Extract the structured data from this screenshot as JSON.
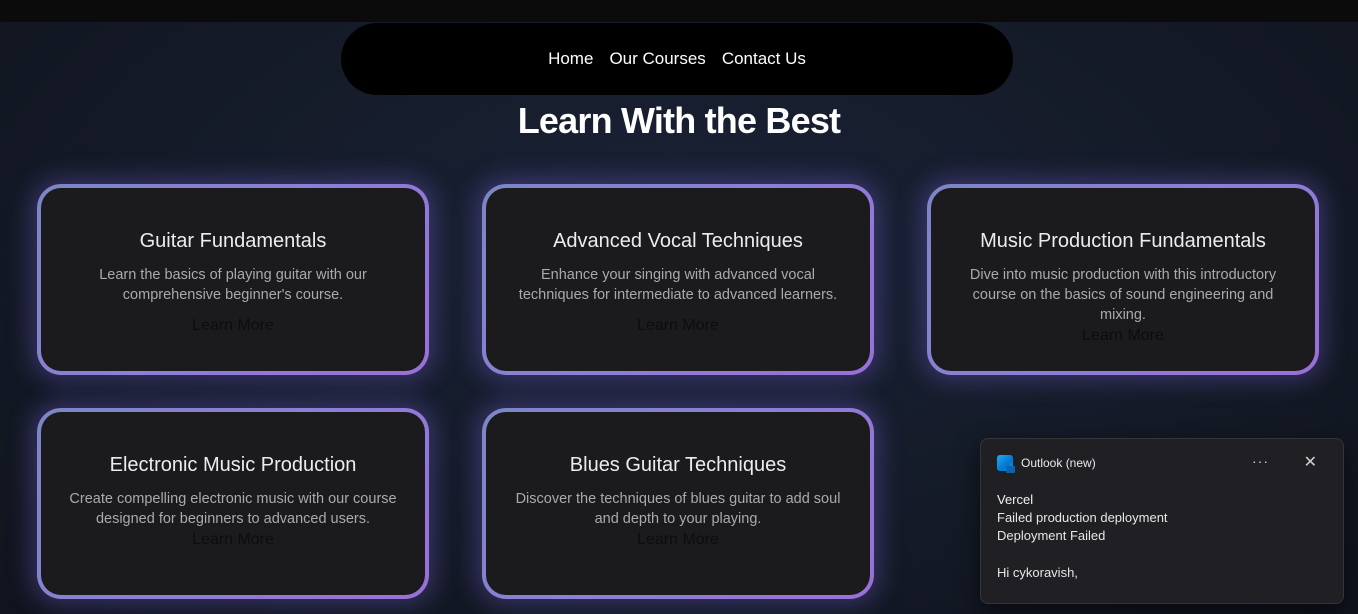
{
  "nav": {
    "items": [
      "Home",
      "Our Courses",
      "Contact Us"
    ]
  },
  "heading": "Learn With the Best",
  "courses": [
    {
      "title": "Guitar Fundamentals",
      "description": "Learn the basics of playing guitar with our comprehensive beginner's course.",
      "link": "Learn More"
    },
    {
      "title": "Advanced Vocal Techniques",
      "description": "Enhance your singing with advanced vocal techniques for intermediate to advanced learners.",
      "link": "Learn More"
    },
    {
      "title": "Music Production Fundamentals",
      "description": "Dive into music production with this introductory course on the basics of sound engineering and mixing.",
      "link": "Learn More"
    },
    {
      "title": "Electronic Music Production",
      "description": "Create compelling electronic music with our course designed for beginners to advanced users.",
      "link": "Learn More"
    },
    {
      "title": "Blues Guitar Techniques",
      "description": "Discover the techniques of blues guitar to add soul and depth to your playing.",
      "link": "Learn More"
    }
  ],
  "notification": {
    "app": "Outlook (new)",
    "app_icon": "outlook-icon",
    "more": "···",
    "close": "✕",
    "sender": "Vercel",
    "subject": "Failed production deployment",
    "preview": "Deployment Failed",
    "greeting": "Hi cykoravish,"
  },
  "colors": {
    "background": "#151a26",
    "card_border_start": "#7c86c4",
    "card_border_end": "#9a6fd8",
    "card_fill": "#1b1b1e",
    "nav_bg": "#000000"
  }
}
